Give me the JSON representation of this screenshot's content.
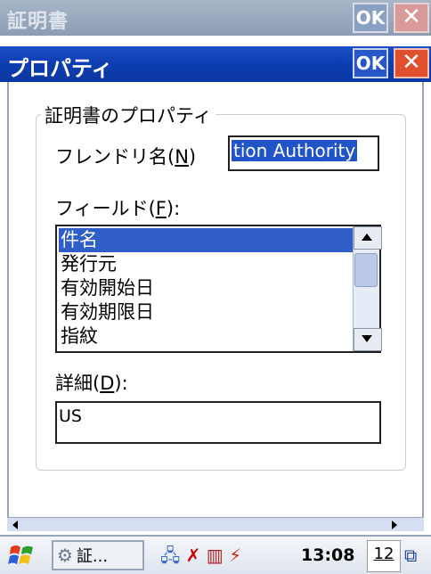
{
  "background_window": {
    "title": "証明書",
    "ok_label": "OK",
    "close_label": "✕"
  },
  "dialog": {
    "title": "プロパティ",
    "ok_label": "OK",
    "close_label": "✕"
  },
  "group": {
    "label": "証明書のプロパティ",
    "friendly_name_label_prefix": "フレンドリ名(",
    "friendly_name_accel": "N",
    "friendly_name_label_suffix": ")",
    "friendly_name_value": "tion Authority",
    "fields_label_prefix": "フィールド(",
    "fields_accel": "F",
    "fields_label_suffix": "):",
    "fields": [
      "件名",
      "発行元",
      "有効開始日",
      "有効期限日",
      "指紋"
    ],
    "selected_field_index": 0,
    "details_label_prefix": "詳細(",
    "details_accel": "D",
    "details_label_suffix": "):",
    "details_value": "US"
  },
  "taskbar": {
    "task_label": "証...",
    "tray_icons": [
      "network-icon",
      "antenna-off-icon",
      "signal-icon",
      "battery-charging-icon"
    ],
    "clock": "13:08",
    "date_label": "12"
  },
  "colors": {
    "title_active": "#0d3db0",
    "selection": "#2f5ec8",
    "close_button": "#e0502e"
  }
}
